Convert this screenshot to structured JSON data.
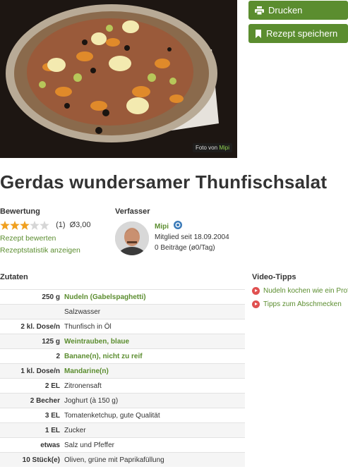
{
  "photo": {
    "credit_prefix": "Foto von",
    "credit_user": "Mipi"
  },
  "buttons": {
    "print": "Drucken",
    "save": "Rezept speichern"
  },
  "title": "Gerdas wundersamer Thunfischsalat",
  "rating": {
    "heading": "Bewertung",
    "stars": 3,
    "max": 5,
    "count": "(1)",
    "average": "Ø3,00",
    "rate_link": "Rezept bewerten",
    "stats_link": "Rezeptstatistik anzeigen"
  },
  "author": {
    "heading": "Verfasser",
    "name": "Mipi",
    "since": "Mitglied seit 18.09.2004",
    "posts": "0 Beiträge (ø0/Tag)"
  },
  "zutaten": {
    "heading": "Zutaten",
    "rows": [
      {
        "amount": "250 g",
        "name": "Nudeln (Gabelspaghetti)",
        "link": true
      },
      {
        "amount": "",
        "name": "Salzwasser",
        "link": false
      },
      {
        "amount": "2 kl. Dose/n",
        "name": "Thunfisch in Öl",
        "link": false
      },
      {
        "amount": "125 g",
        "name": "Weintrauben, blaue",
        "link": true
      },
      {
        "amount": "2",
        "name": "Banane(n), nicht zu reif",
        "link": true
      },
      {
        "amount": "1 kl. Dose/n",
        "name": "Mandarine(n)",
        "link": true
      },
      {
        "amount": "2 EL",
        "name": "Zitronensaft",
        "link": false
      },
      {
        "amount": "2 Becher",
        "name": "Joghurt (à 150 g)",
        "link": false
      },
      {
        "amount": "3 EL",
        "name": "Tomatenketchup, gute Qualität",
        "link": false
      },
      {
        "amount": "1 EL",
        "name": "Zucker",
        "link": false
      },
      {
        "amount": "etwas",
        "name": "Salz und Pfeffer",
        "link": false
      },
      {
        "amount": "10 Stück(e)",
        "name": "Oliven, grüne mit Paprikafüllung",
        "link": false
      }
    ]
  },
  "video": {
    "heading": "Video-Tipps",
    "items": [
      "Nudeln kochen wie ein Profi",
      "Tipps zum Abschmecken"
    ]
  },
  "colors": {
    "accent": "#5b8d2f",
    "star": "#f0a020"
  }
}
